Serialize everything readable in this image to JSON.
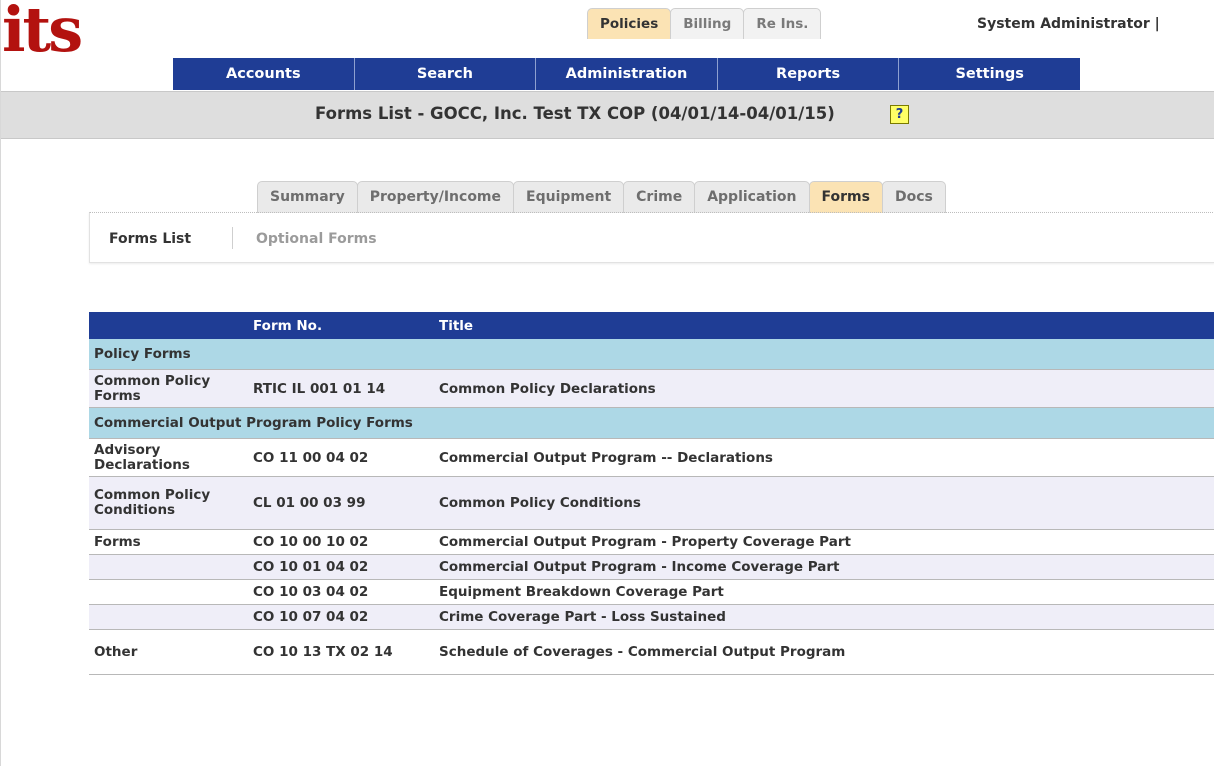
{
  "logo": "its",
  "system_tabs": [
    {
      "label": "Policies",
      "active": true
    },
    {
      "label": "Billing",
      "active": false
    },
    {
      "label": "Re Ins.",
      "active": false
    }
  ],
  "user": "System Administrator  |",
  "main_nav": [
    "Accounts",
    "Search",
    "Administration",
    "Reports",
    "Settings"
  ],
  "page_title": "Forms List - GOCC, Inc. Test TX COP (04/01/14-04/01/15)",
  "help_icon": "?",
  "policy_tabs": [
    {
      "label": "Summary",
      "active": false
    },
    {
      "label": "Property/Income",
      "active": false
    },
    {
      "label": "Equipment",
      "active": false
    },
    {
      "label": "Crime",
      "active": false
    },
    {
      "label": "Application",
      "active": false
    },
    {
      "label": "Forms",
      "active": true
    },
    {
      "label": "Docs",
      "active": false
    }
  ],
  "subnav": {
    "active": "Forms List",
    "other": "Optional Forms"
  },
  "table": {
    "headers": [
      "",
      "Form No.",
      "Title"
    ],
    "rows": [
      {
        "type": "section",
        "label": "Policy Forms"
      },
      {
        "type": "row",
        "category": "Common Policy Forms",
        "form_no": "RTIC IL 001 01 14",
        "title": "Common Policy Declarations"
      },
      {
        "type": "section",
        "label": "Commercial Output Program Policy Forms"
      },
      {
        "type": "row",
        "category": "Advisory Declarations",
        "form_no": "CO 11 00 04 02",
        "title": "Commercial Output Program -- Declarations"
      },
      {
        "type": "row",
        "category": "Common Policy Conditions",
        "form_no": "CL 01 00 03 99",
        "title": "Common Policy Conditions"
      },
      {
        "type": "row",
        "category": "Forms",
        "form_no": "CO 10 00 10 02",
        "title": "Commercial Output Program - Property Coverage Part"
      },
      {
        "type": "row",
        "category": "",
        "form_no": "CO 10 01 04 02",
        "title": "Commercial Output Program - Income Coverage Part"
      },
      {
        "type": "row",
        "category": "",
        "form_no": "CO 10 03 04 02",
        "title": "Equipment Breakdown Coverage Part"
      },
      {
        "type": "row",
        "category": "",
        "form_no": "CO 10 07 04 02",
        "title": "Crime Coverage Part - Loss Sustained"
      },
      {
        "type": "row",
        "category": "Other",
        "form_no": "CO 10 13 TX 02 14",
        "title": "Schedule of Coverages - Commercial Output Program"
      }
    ]
  },
  "colors": {
    "nav_blue": "#1f3d95",
    "logo_red": "#b3120f",
    "tab_active": "#fbe3b4",
    "section_bg": "#add8e6"
  }
}
